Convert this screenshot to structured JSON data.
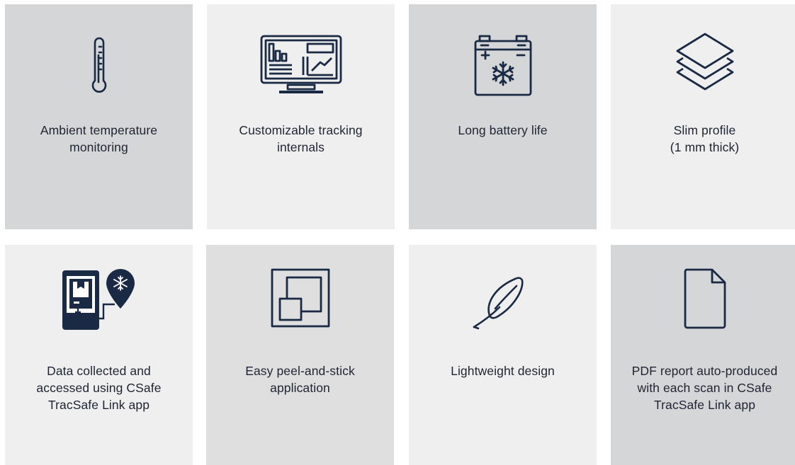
{
  "features": [
    {
      "icon": "thermometer-icon",
      "bg": "#d5d6d8",
      "lines": [
        "Ambient temperature",
        "monitoring"
      ]
    },
    {
      "icon": "dashboard-monitor-icon",
      "bg": "#efefef",
      "lines": [
        "Customizable tracking",
        "internals"
      ]
    },
    {
      "icon": "battery-snowflake-icon",
      "bg": "#d5d6d8",
      "lines": [
        "Long battery life"
      ]
    },
    {
      "icon": "layers-icon",
      "bg": "#efefef",
      "lines": [
        "Slim profile",
        "(1 mm thick)"
      ]
    },
    {
      "icon": "phone-location-icon",
      "bg": "#efefef",
      "lines": [
        "Data collected and",
        "accessed using CSafe",
        "TracSafe Link app"
      ]
    },
    {
      "icon": "peel-stick-icon",
      "bg": "#dfdfdf",
      "lines": [
        "Easy peel-and-stick",
        "application"
      ]
    },
    {
      "icon": "feather-icon",
      "bg": "#efefef",
      "lines": [
        "Lightweight design"
      ]
    },
    {
      "icon": "document-icon",
      "bg": "#d5d6d8",
      "lines": [
        "PDF report auto-produced",
        "with each scan in CSafe",
        "TracSafe Link app"
      ]
    }
  ],
  "colors": {
    "icon_stroke": "#1a2a44",
    "text": "#1f2433"
  }
}
